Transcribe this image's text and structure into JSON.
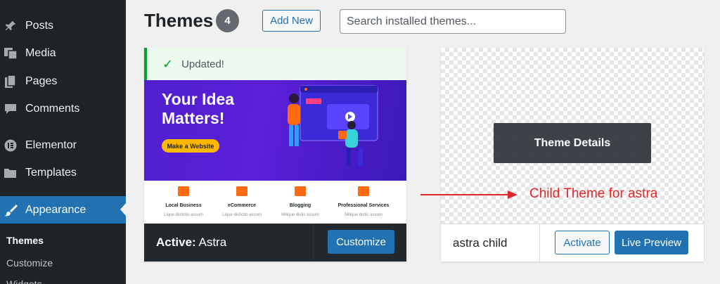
{
  "sidebar": {
    "items": [
      {
        "label": "Posts",
        "icon": "pin-icon"
      },
      {
        "label": "Media",
        "icon": "media-icon"
      },
      {
        "label": "Pages",
        "icon": "pages-icon"
      },
      {
        "label": "Comments",
        "icon": "comment-icon"
      },
      {
        "label": "Elementor",
        "icon": "elementor-icon"
      },
      {
        "label": "Templates",
        "icon": "folder-icon"
      },
      {
        "label": "Appearance",
        "icon": "paintbrush-icon"
      }
    ],
    "submenu": [
      {
        "label": "Themes"
      },
      {
        "label": "Customize"
      },
      {
        "label": "Widgets"
      }
    ]
  },
  "header": {
    "title": "Themes",
    "count": "4",
    "add_new": "Add New",
    "search_placeholder": "Search installed themes..."
  },
  "active_theme": {
    "notice": "Updated!",
    "screenshot": {
      "hero_title": "Your Idea Matters!",
      "hero_button": "Make a Website",
      "services": [
        {
          "name": "Local Business",
          "desc": "Lique distictio assum"
        },
        {
          "name": "eCommerce",
          "desc": "Lique distictio assum"
        },
        {
          "name": "Blogging",
          "desc": "Milique distic assum"
        },
        {
          "name": "Professional Services",
          "desc": "Milique distic assum"
        }
      ]
    },
    "active_prefix": "Active:",
    "name": "Astra",
    "customize": "Customize"
  },
  "child_theme": {
    "details": "Theme Details",
    "name": "astra child",
    "activate": "Activate",
    "live_preview": "Live Preview"
  },
  "annotation": {
    "text": "Child Theme for astra",
    "color": "#e0262b"
  },
  "colors": {
    "sidebar_bg": "#1d2327",
    "accent": "#2271b1",
    "success": "#00a32a"
  }
}
